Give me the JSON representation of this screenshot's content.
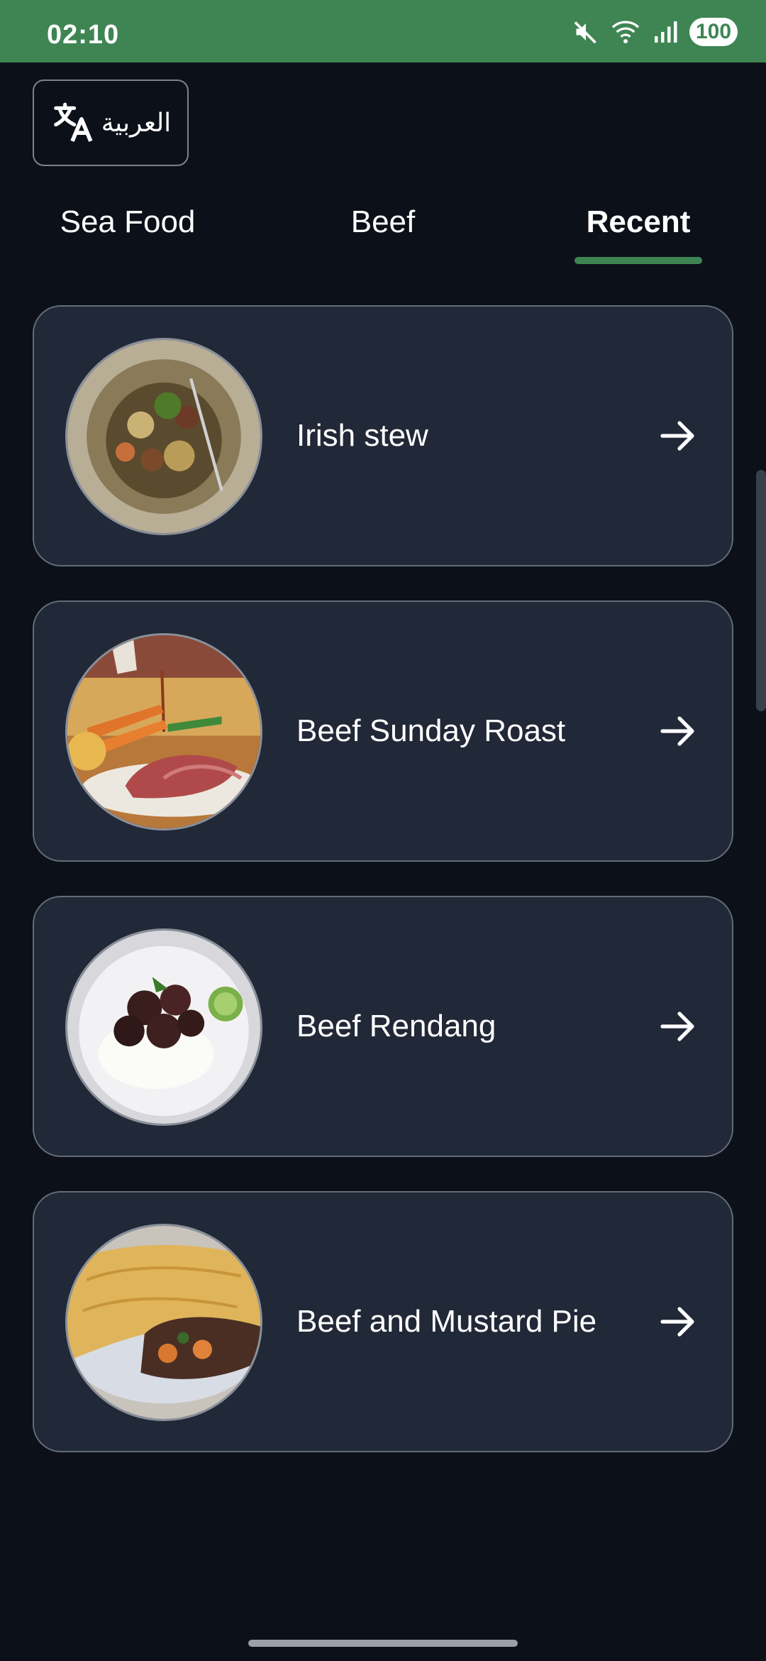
{
  "status_bar": {
    "time": "02:10",
    "battery": "100",
    "background": "#3f8553",
    "icons": [
      "mute-icon",
      "wifi-icon",
      "signal-icon",
      "battery-icon"
    ]
  },
  "language_button": {
    "label": "العربية",
    "icon": "translate-icon"
  },
  "tabs": [
    {
      "label": "Sea Food",
      "active": false
    },
    {
      "label": "Beef",
      "active": false
    },
    {
      "label": "Recent",
      "active": true
    }
  ],
  "accent_color": "#3f8553",
  "recipes": [
    {
      "name": "Irish stew",
      "icon": "arrow-right-icon"
    },
    {
      "name": "Beef Sunday Roast",
      "icon": "arrow-right-icon"
    },
    {
      "name": "Beef Rendang",
      "icon": "arrow-right-icon"
    },
    {
      "name": "Beef and Mustard Pie",
      "icon": "arrow-right-icon"
    }
  ]
}
